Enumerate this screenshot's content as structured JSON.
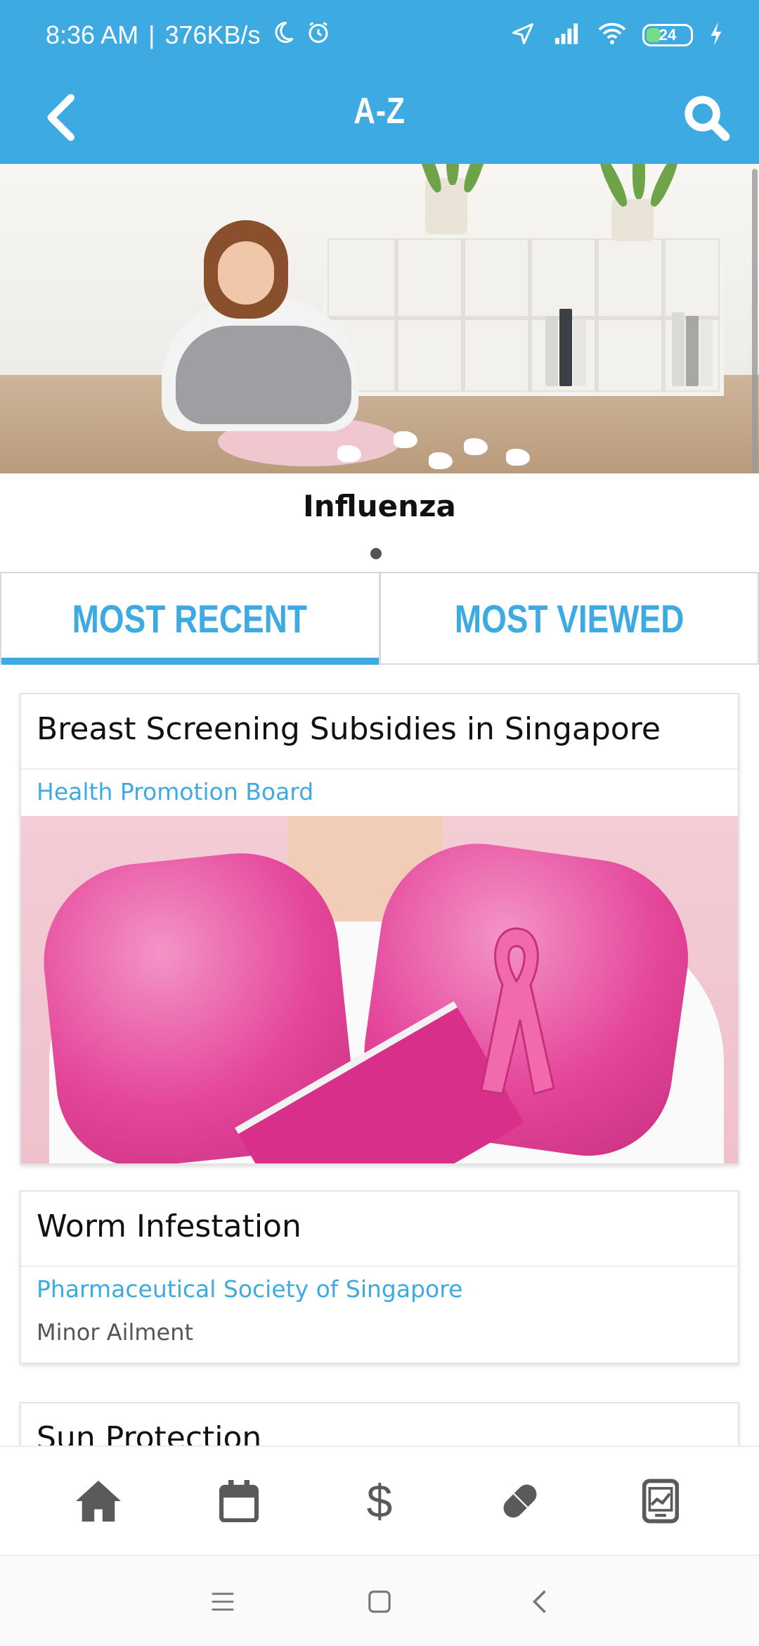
{
  "status_bar": {
    "time": "8:36 AM",
    "separator": "|",
    "network_speed": "376KB/s",
    "battery_level": "24",
    "icons": [
      "moon-icon",
      "alarm-icon",
      "location-icon",
      "signal-icon",
      "wifi-icon",
      "battery-icon",
      "charging-icon"
    ]
  },
  "app_bar": {
    "title": "A-Z",
    "back_icon": "chevron-left-icon",
    "search_icon": "search-icon",
    "background_color": "#3daae2"
  },
  "hero": {
    "title": "Influenza",
    "page_indicator_count": 1,
    "active_page": 1
  },
  "tabs": [
    {
      "label": "MOST RECENT",
      "active": true
    },
    {
      "label": "MOST VIEWED",
      "active": false
    }
  ],
  "articles": [
    {
      "title": "Breast Screening Subsidies in Singapore",
      "source": "Health Promotion Board",
      "has_image": true
    },
    {
      "title": "Worm Infestation",
      "source": "Pharmaceutical Society of Singapore",
      "category": "Minor Ailment"
    },
    {
      "title": "Sun Protection"
    }
  ],
  "bottom_nav": {
    "items": [
      {
        "icon": "home-icon"
      },
      {
        "icon": "calendar-icon"
      },
      {
        "icon": "dollar-icon",
        "glyph": "$"
      },
      {
        "icon": "pill-icon"
      },
      {
        "icon": "health-report-icon"
      }
    ]
  },
  "system_nav": {
    "items": [
      "menu-icon",
      "home-square-icon",
      "back-chevron-icon"
    ]
  },
  "colors": {
    "accent": "#3daae2",
    "text_primary": "#111111",
    "text_secondary": "#555555",
    "nav_icon": "#5a5a5a"
  }
}
